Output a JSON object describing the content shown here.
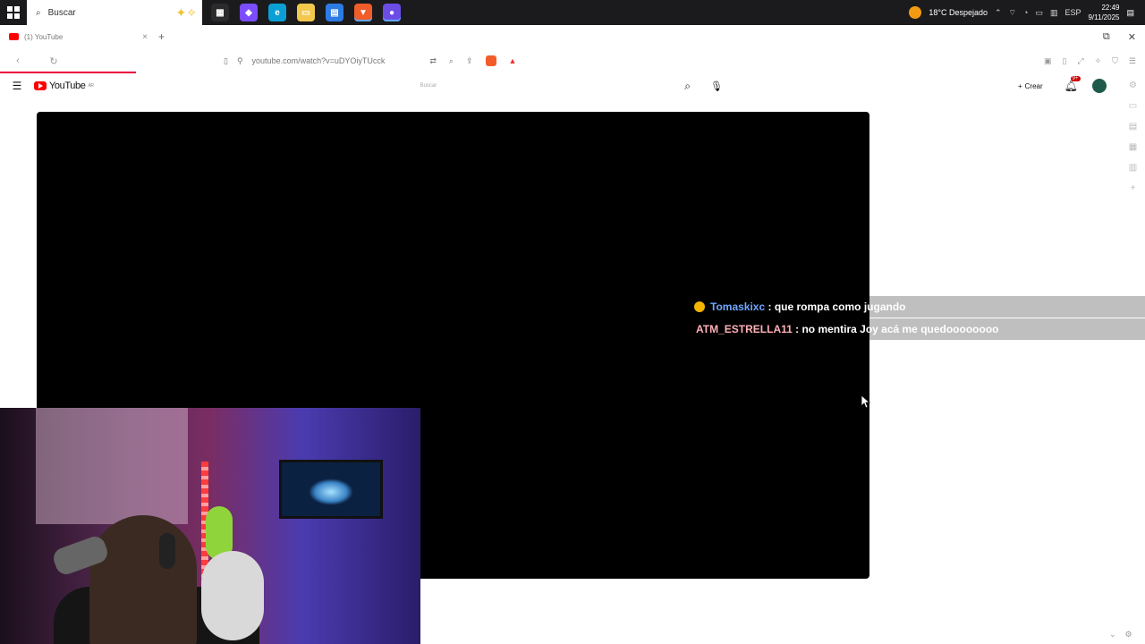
{
  "taskbar": {
    "search_placeholder": "Buscar",
    "apps": [
      {
        "name": "task-view",
        "color": "#2b2b2b",
        "glyph": "▦"
      },
      {
        "name": "copilot",
        "color": "#7b4dff",
        "glyph": "◆"
      },
      {
        "name": "edge",
        "color": "#0aa0d6",
        "glyph": "e"
      },
      {
        "name": "file-explorer",
        "color": "#f2c94c",
        "glyph": "▭"
      },
      {
        "name": "store",
        "color": "#2d7be5",
        "glyph": "▤"
      },
      {
        "name": "brave",
        "color": "#f25c2a",
        "glyph": "▼"
      },
      {
        "name": "app-purple",
        "color": "#6b4de6",
        "glyph": "●"
      }
    ],
    "weather": "18°C  Despejado",
    "lang": "ESP",
    "time": "22:49",
    "date": "9/11/2025"
  },
  "tabstrip": {
    "tab_title": "(1) YouTube",
    "close": "×",
    "new_tab": "+"
  },
  "addressbar": {
    "url": "youtube.com/watch?v=uDYOiyTUcck"
  },
  "youtube": {
    "logo_text": "YouTube",
    "country_code": "AR",
    "search_placeholder": "Buscar",
    "create_label": "Crear",
    "notif_count": "9+"
  },
  "chat": [
    {
      "user": "Tomaskixc",
      "sep": " : ",
      "message": "que rompa como jugando",
      "badge": true,
      "user_color": "#6fa8ff"
    },
    {
      "user": "ATM_ESTRELLA11",
      "sep": " : ",
      "message": "no mentira Joy acá me quedoooooooo",
      "badge": false,
      "user_color": "#ffb0b8"
    }
  ]
}
